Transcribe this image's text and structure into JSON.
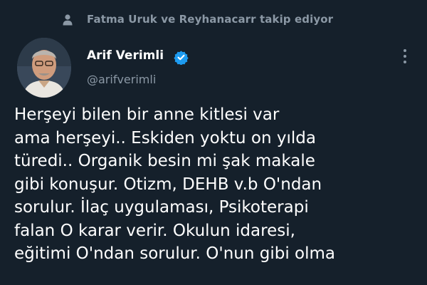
{
  "context": {
    "icon": "person-icon",
    "text": "Fatma Uruk ve Reyhanacarr takip ediyor"
  },
  "author": {
    "avatar_icon": "avatar",
    "name": "Arif Verimli",
    "verified_icon": "verified-badge-icon",
    "handle": "@arifverimli"
  },
  "menu": {
    "icon": "more-options-icon"
  },
  "tweet": {
    "lines": [
      "Herşeyi bilen bir anne kitlesi var",
      "ama herşeyi.. Eskiden yoktu on yılda",
      "türedi.. Organik besin mi şak makale",
      "gibi konuşur. Otizm, DEHB v.b O'ndan",
      "sorulur. İlaç uygulaması, Psikoterapi",
      "falan O karar verir. Okulun idaresi,",
      "eğitimi O'ndan sorulur. O'nun gibi olma"
    ]
  },
  "colors": {
    "background": "#15202b",
    "secondary_text": "#8b98a5",
    "verified": "#1d9bf0"
  }
}
